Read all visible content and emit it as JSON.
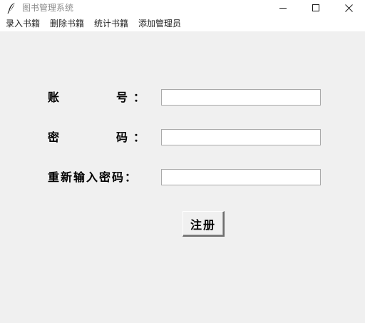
{
  "window": {
    "title": "图书管理系统",
    "icon": "feather-icon",
    "controls": {
      "minimize": "minimize-icon",
      "maximize": "maximize-icon",
      "close": "close-icon"
    }
  },
  "menu": {
    "items": [
      {
        "label": "录入书籍"
      },
      {
        "label": "删除书籍"
      },
      {
        "label": "统计书籍"
      },
      {
        "label": "添加管理员"
      }
    ]
  },
  "form": {
    "account_label": "账　　　号：",
    "password_label": "密　　　码：",
    "confirm_label": "重新输入密码：",
    "account_value": "",
    "password_value": "",
    "confirm_value": "",
    "submit_label": "注册"
  },
  "colors": {
    "window_bg": "#f0f0f0",
    "titlebar_bg": "#ffffff",
    "title_text": "#8c8c8c",
    "input_border": "#a9a9a9"
  }
}
